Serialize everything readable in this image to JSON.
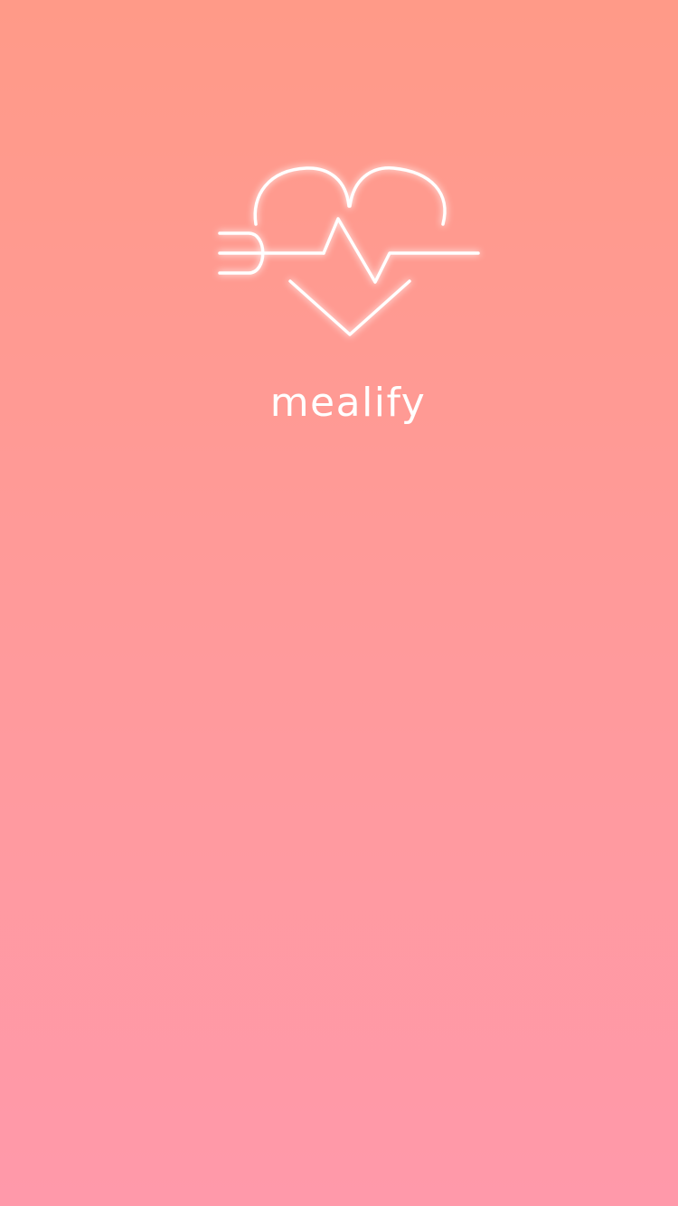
{
  "app": {
    "name": "mealify"
  },
  "logo": {
    "icon": "heart-fork-heartbeat-icon",
    "stroke_color": "#ffffff"
  },
  "background": {
    "gradient_top": "#ff9a88",
    "gradient_bottom": "#ff99aa"
  }
}
